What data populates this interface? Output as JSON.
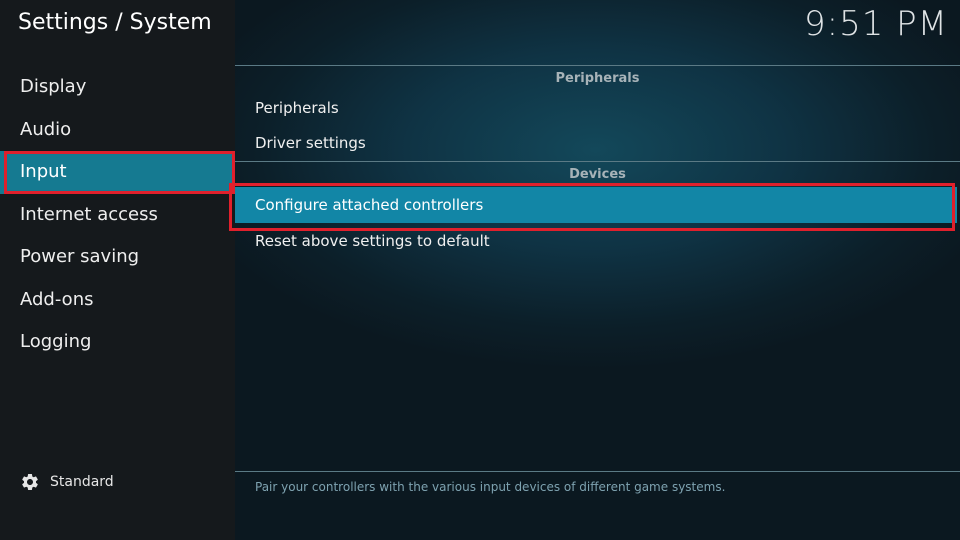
{
  "header": {
    "title": "Settings / System",
    "clock": "9:51 PM"
  },
  "sidebar": {
    "items": [
      {
        "label": "Display"
      },
      {
        "label": "Audio"
      },
      {
        "label": "Input"
      },
      {
        "label": "Internet access"
      },
      {
        "label": "Power saving"
      },
      {
        "label": "Add-ons"
      },
      {
        "label": "Logging"
      }
    ],
    "selected_index": 2,
    "level": {
      "icon": "gear-icon",
      "label": "Standard"
    }
  },
  "main": {
    "sections": [
      {
        "header": "Peripherals",
        "items": [
          {
            "label": "Peripherals"
          },
          {
            "label": "Driver settings"
          }
        ]
      },
      {
        "header": "Devices",
        "items": [
          {
            "label": "Configure attached controllers"
          },
          {
            "label": "Reset above settings to default"
          }
        ]
      }
    ],
    "help_text": "Pair your controllers with the various input devices of different game systems."
  },
  "colors": {
    "accent": "#1286a6",
    "highlight_outline": "#e0202c",
    "sidebar_bg": "#15191c"
  }
}
